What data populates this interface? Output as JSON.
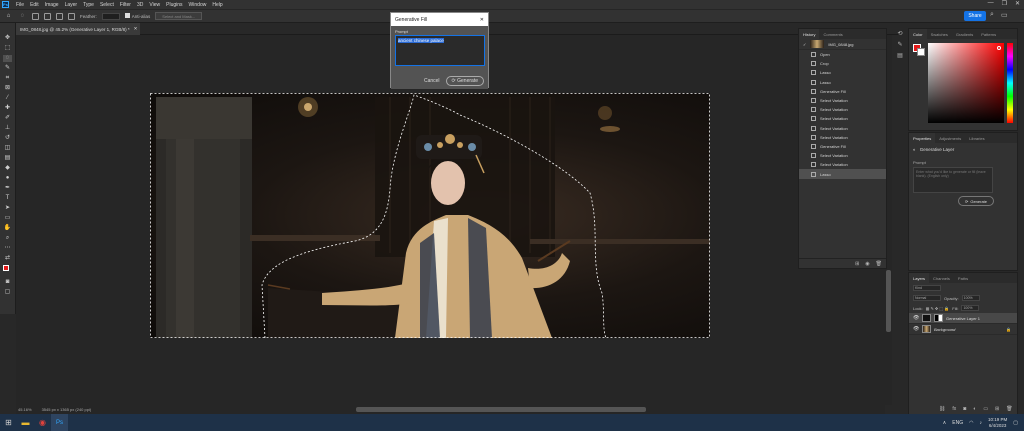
{
  "app": {
    "logo": "Ps"
  },
  "menu": [
    "File",
    "Edit",
    "Image",
    "Layer",
    "Type",
    "Select",
    "Filter",
    "3D",
    "View",
    "Plugins",
    "Window",
    "Help"
  ],
  "window_controls": [
    "—",
    "❐",
    "✕"
  ],
  "options_bar": {
    "feather_label": "Feather:",
    "feather_value": "",
    "antialias_label": "Anti-alias",
    "select_mask_label": "Select and Mask...",
    "share_label": "Share"
  },
  "document_tab": {
    "title": "IMG_0848.jpg @ 45.2% (Generative Layer 1, RGB/8) *",
    "close": "✕"
  },
  "status": {
    "zoom": "45.16%",
    "dimensions": "3545 px x 1365 px (240 ppi)"
  },
  "dialog": {
    "title": "Generative Fill",
    "close": "✕",
    "prompt_label": "Prompt",
    "prompt_value": "ancient chinese palace",
    "cancel": "Cancel",
    "generate": "Generate"
  },
  "history": {
    "tabs": [
      "History",
      "Comments"
    ],
    "snapshot": "IMG_0848.jpg",
    "items": [
      "Open",
      "Crop",
      "Lasso",
      "Lasso",
      "Generative Fill",
      "Select Variation",
      "Select Variation",
      "Select Variation",
      "Select Variation",
      "Select Variation",
      "Generative Fill",
      "Select Variation",
      "Select Variation",
      "Lasso"
    ],
    "selected_index": 13
  },
  "color_panel": {
    "tabs": [
      "Color",
      "Swatches",
      "Gradients",
      "Patterns"
    ],
    "foreground": "#e51b1b",
    "background": "#ffffff"
  },
  "properties": {
    "tabs": [
      "Properties",
      "Adjustments",
      "Libraries"
    ],
    "layer_kind": "Generative Layer",
    "prompt_label": "Prompt",
    "placeholder": "Enter what you'd like to generate or fill (leave blank). (English only)",
    "generate": "Generate"
  },
  "layers_panel": {
    "tabs": [
      "Layers",
      "Channels",
      "Paths"
    ],
    "kind_label": "Kind",
    "blend_mode": "Normal",
    "opacity_label": "Opacity:",
    "opacity_value": "100%",
    "lock_label": "Lock:",
    "fill_label": "Fill:",
    "fill_value": "100%",
    "layers": [
      {
        "name": "Generative Layer 1"
      },
      {
        "name": "Background"
      }
    ]
  },
  "taskbar": {
    "language": "ENG",
    "time": "10:19 PM",
    "date": "6/4/2023"
  }
}
